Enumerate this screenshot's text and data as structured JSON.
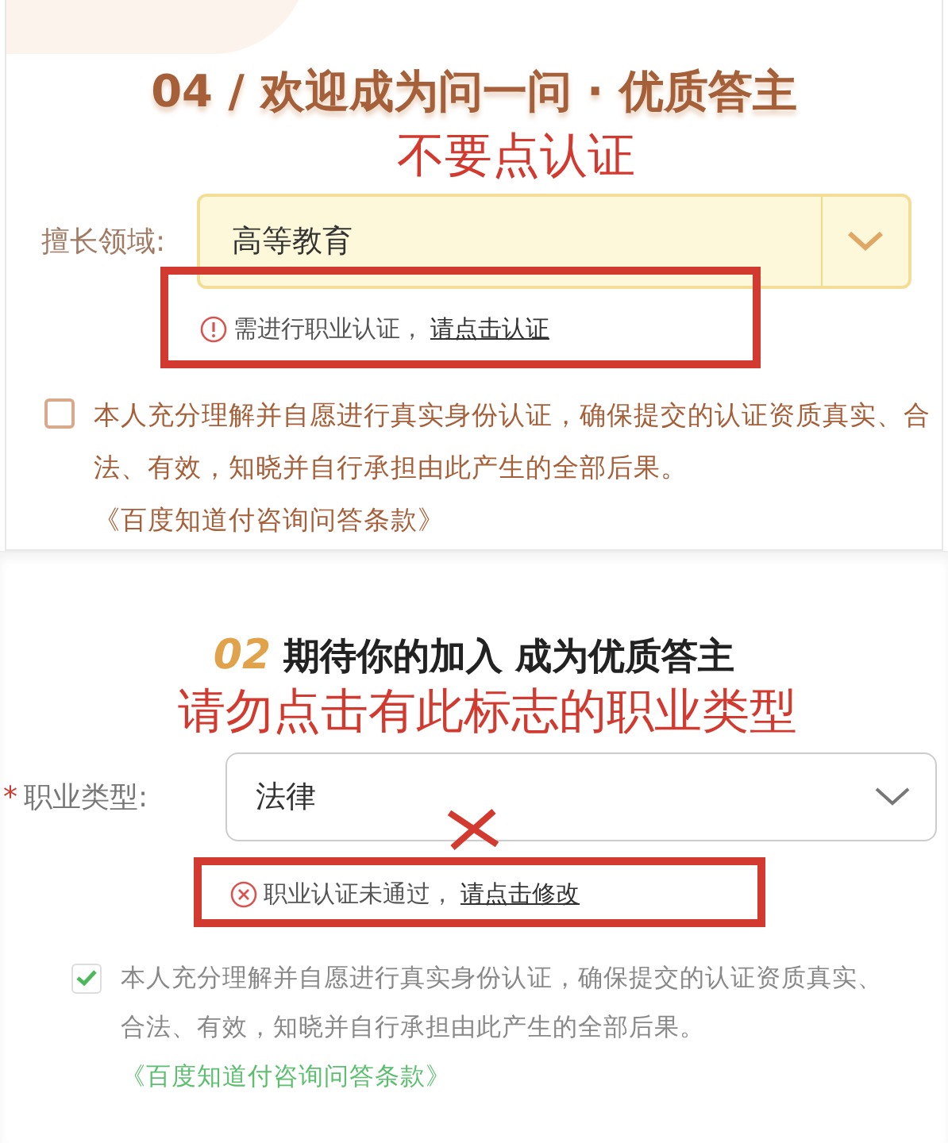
{
  "panels": [
    {
      "kind": "warm",
      "title": "04 / 欢迎成为问一问 · 优质答主",
      "annotation": "不要点认证",
      "field": {
        "label": "擅长领域:",
        "value": "高等教育"
      },
      "notice": {
        "kind": "warning",
        "text": "需进行职业认证，",
        "link": "请点击认证",
        "highlighted": true
      },
      "agreement": {
        "checked": false,
        "text": "本人充分理解并自愿进行真实身份认证，确保提交的认证资质真实、合法、有效，知晓并自行承担由此产生的全部后果。",
        "link": "《百度知道付咨询问答条款》"
      }
    },
    {
      "kind": "plain",
      "number": "02",
      "title": "期待你的加入 成为优质答主",
      "annotation": "请勿点击有此标志的职业类型",
      "cross_mark": true,
      "field": {
        "required_mark": "*",
        "label": "职业类型:",
        "value": "法律"
      },
      "notice": {
        "kind": "error",
        "text": "职业认证未通过，",
        "link": "请点击修改",
        "highlighted": true
      },
      "agreement": {
        "checked": true,
        "text": "本人充分理解并自愿进行真实身份认证，确保提交的认证资质真实、合法、有效，知晓并自行承担由此产生的全部后果。",
        "link": "《百度知道付咨询问答条款》"
      }
    }
  ]
}
